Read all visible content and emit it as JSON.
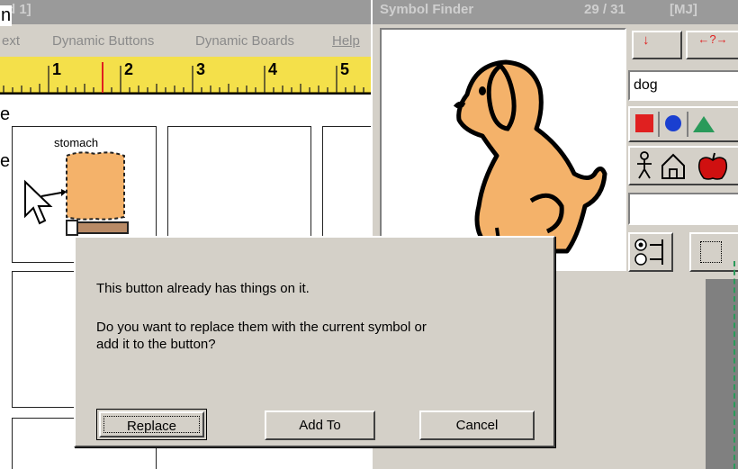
{
  "main_window": {
    "title_fragment": "d 1]",
    "menu": [
      "ext",
      "Dynamic Buttons",
      "Dynamic Boards",
      "Help"
    ],
    "left_fragments": [
      "n",
      "e",
      "e"
    ],
    "ruler_marks": [
      "1",
      "2",
      "3",
      "4",
      "5"
    ],
    "cell_label": "stomach"
  },
  "symbol_finder": {
    "title": "Symbol Finder",
    "counter": "29 / 31",
    "extra": "[MJ]",
    "search_value": "dog",
    "top_btn_1": "↓",
    "top_btn_2": "←?→"
  },
  "dialog": {
    "message_1": "This button already has things on it.",
    "message_2": "Do you want to replace them with the current symbol or",
    "message_3": "add it to the button?",
    "replace_label": "Replace",
    "add_to_label": "Add To",
    "cancel_label": "Cancel"
  },
  "colors": {
    "ruler": "#f4e04a",
    "dog": "#f4b26a",
    "window_gray": "#d4d0c8",
    "red": "#e02020",
    "blue": "#1a3fd0",
    "green": "#2a9a5a"
  }
}
